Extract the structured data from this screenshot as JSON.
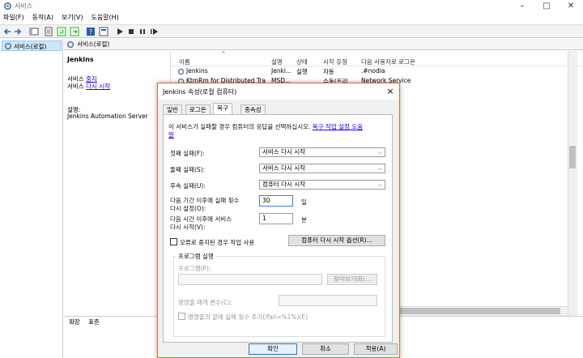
{
  "window": {
    "title": "서비스"
  },
  "menu": [
    "파일(F)",
    "동작(A)",
    "보기(V)",
    "도움말(H)"
  ],
  "tree": {
    "root": "서비스(로컬)"
  },
  "header": {
    "title": "서비스(로컬)"
  },
  "left_pane": {
    "name": "Jenkins",
    "stop_prefix": "서비스 ",
    "stop_link": "중지",
    "restart_prefix": "서비스 ",
    "restart_link": "다시 시작",
    "desc_label": "설명:",
    "desc": "Jenkins Automation Server"
  },
  "list": {
    "columns": [
      "이름",
      "설명",
      "상태",
      "시작 유형",
      "다음 사용자로 로그온"
    ],
    "rows": [
      {
        "name": "Jenkins",
        "desc": "Jenki...",
        "status": "실행",
        "start": "자동",
        "logon": ".#nodia"
      },
      {
        "name": "KtmRm for Distributed Tra",
        "desc": "MSD...",
        "status": "",
        "start": "수동(트리...",
        "logon": "Network Service"
      }
    ]
  },
  "bottom_tabs": [
    "확장",
    "표준"
  ],
  "dialog": {
    "title": "Jenkins 속성(로컬 컴퓨터)",
    "close": "×",
    "tabs": [
      "일반",
      "로그온",
      "복구",
      "종속성"
    ],
    "intro": "이 서비스가 실패할 경우 컴퓨터의 응답을 선택하십시오.",
    "intro_link1": "복구 작업 설정 도움",
    "intro_link2": "말",
    "first_failure_label": "첫째 실패(F):",
    "first_failure_value": "서비스 다시 시작",
    "second_failure_label": "둘째 실패(S):",
    "second_failure_value": "서비스 다시 시작",
    "subsequent_label": "후속 실패(U):",
    "subsequent_value": "컴퓨터 다시 시작",
    "reset_label1": "다음 기간 이후에 실패 횟수",
    "reset_label2": "다시 설정(O):",
    "reset_value": "30",
    "reset_unit": "일",
    "restart_label1": "다음 시간 이후에 서비스",
    "restart_label2": "다시 시작(V):",
    "restart_value": "1",
    "restart_unit": "분",
    "stop_error_label": "오류로 중지된 경우 작업 사용",
    "restart_options_button": "컴퓨터 다시 시작 옵션(R)...",
    "program_group": "프로그램 실행",
    "program_label": "프로그램(P):",
    "browse_button": "찾아보기(B)...",
    "cmdline_label": "명령줄 매개 변수(C):",
    "append_label": "명령줄의 끝에 실패 횟수 추가(/fail=%1%)(E)",
    "ok": "확인",
    "cancel": "취소",
    "apply": "적용(A)"
  },
  "colors": {
    "accent": "#1a00ff",
    "dialog_border": "#e26a2f",
    "selection": "#cde6f7"
  }
}
